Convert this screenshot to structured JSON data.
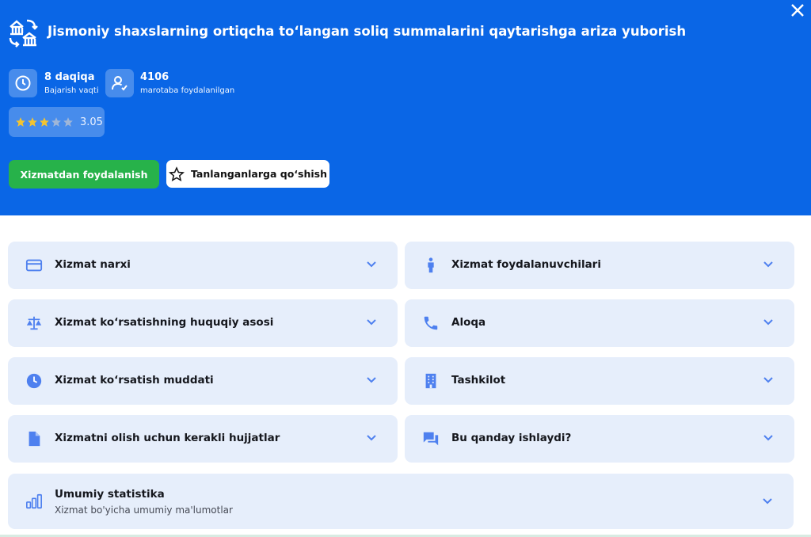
{
  "header": {
    "title": "Jismoniy shaxslarning ortiqcha to‘langan soliq summalarini qaytarishga ariza yuborish",
    "duration_value": "8 daqiqa",
    "duration_label": "Bajarish vaqti",
    "usage_value": "4106",
    "usage_label": "marotaba foydalanilgan",
    "rating_value": "3.05",
    "rating_stars_filled": 3,
    "rating_stars_total": 5
  },
  "actions": {
    "use_service_label": "Xizmatdan foydalanish",
    "add_favorite_label": "Tanlanganlarga qo‘shish"
  },
  "sections": {
    "price": "Xizmat narxi",
    "legal_basis": "Xizmat ko‘rsatishning huquqiy asosi",
    "duration": "Xizmat ko‘rsatish muddati",
    "documents": "Xizmatni olish uchun kerakli hujjatlar",
    "users": "Xizmat foydalanuvchilari",
    "contact": "Aloqa",
    "organization": "Tashkilot",
    "how_it_works": "Bu qanday ishlaydi?",
    "statistics_title": "Umumiy statistika",
    "statistics_subtitle": "Xizmat bo'yicha umumiy ma'lumotlar"
  },
  "colors": {
    "hero_blue": "#0a66e6",
    "primary_green": "#27b24a",
    "card_bg": "#e6eefb",
    "icon_blue": "#4e80ef",
    "star_gold": "#f4c430"
  },
  "icons": {
    "service": "bank-exchange-icon",
    "close": "close-icon",
    "clock": "clock-icon",
    "user": "user-check-icon",
    "star": "star-icon",
    "card": "credit-card-icon",
    "person": "person-icon",
    "scales": "scales-icon",
    "phone": "phone-icon",
    "clock_filled": "clock-filled-icon",
    "building": "building-icon",
    "document": "document-icon",
    "chat": "chat-icon",
    "bar_chart": "bar-chart-icon",
    "chevron": "chevron-down-icon"
  }
}
